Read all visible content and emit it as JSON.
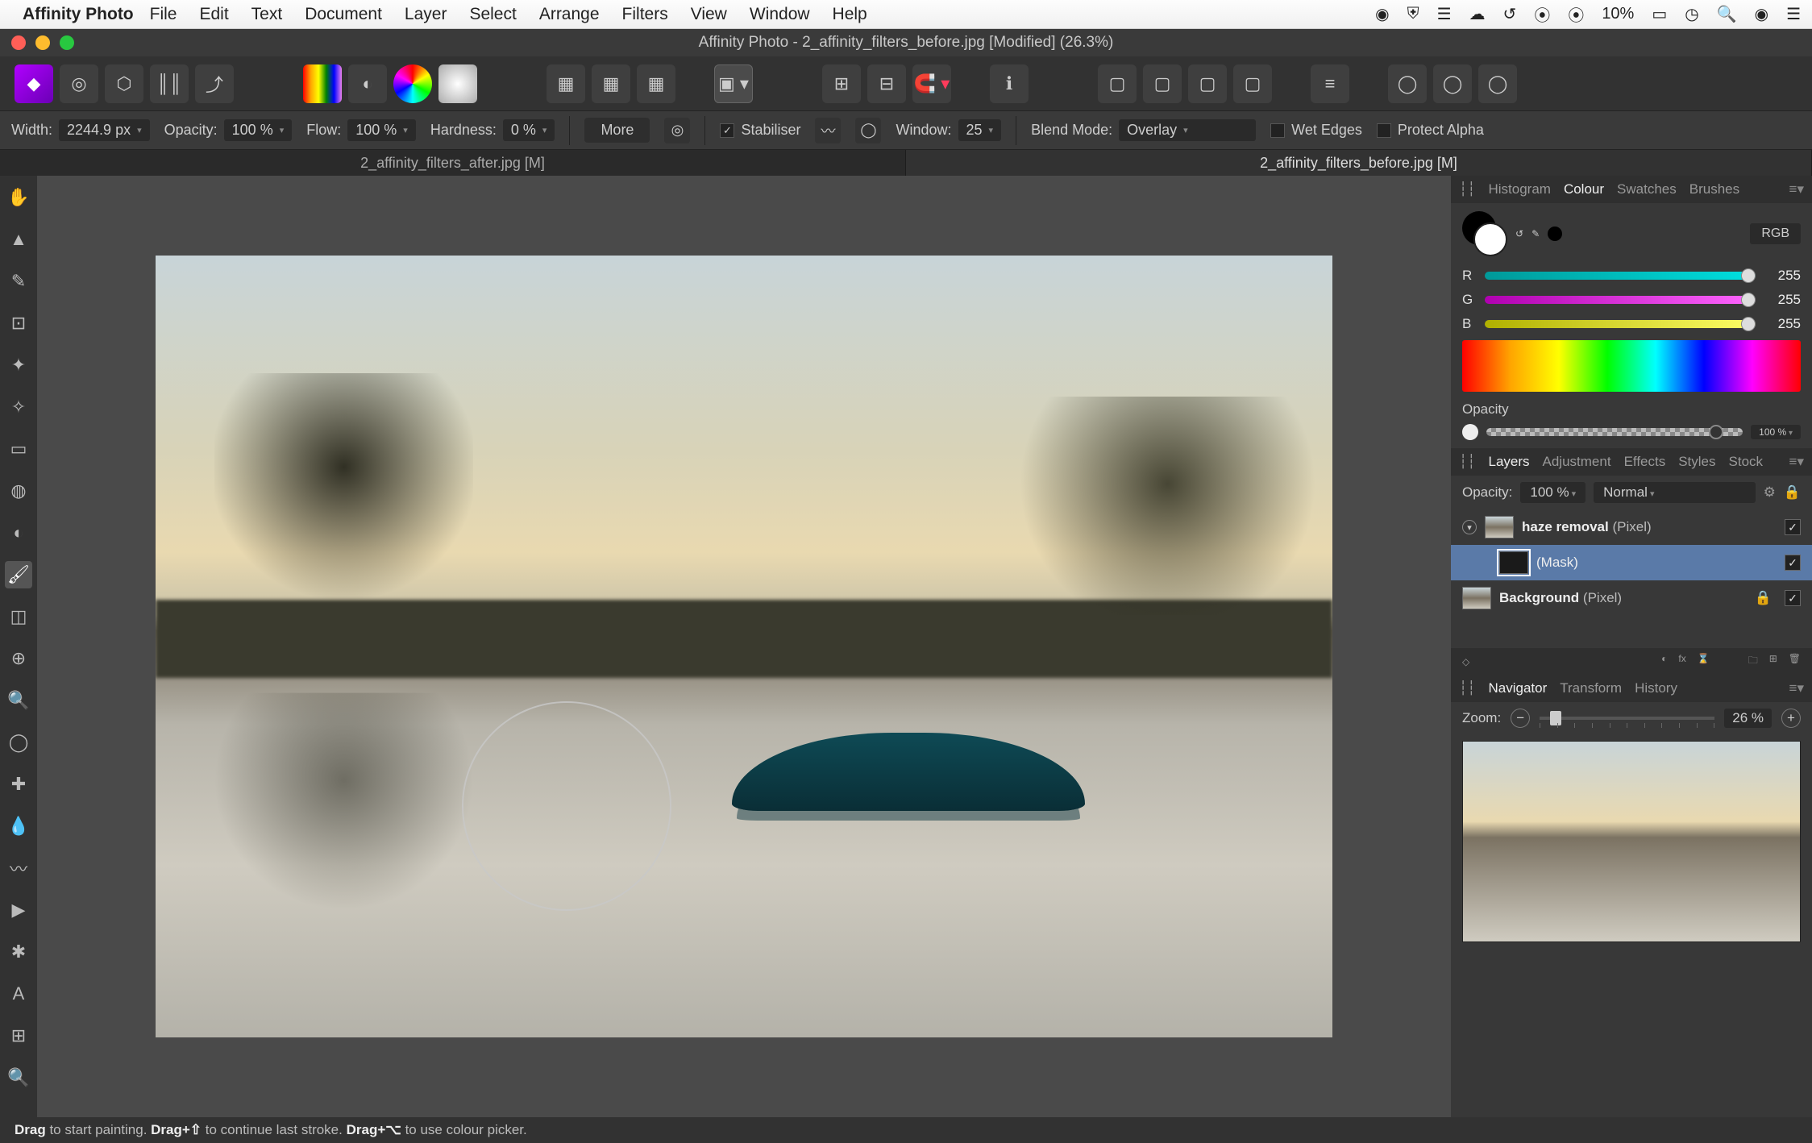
{
  "mac_menu": {
    "app_name": "Affinity Photo",
    "items": [
      "File",
      "Edit",
      "Text",
      "Document",
      "Layer",
      "Select",
      "Arrange",
      "Filters",
      "View",
      "Window",
      "Help"
    ],
    "battery": "10%"
  },
  "window": {
    "title": "Affinity Photo - 2_affinity_filters_before.jpg [Modified] (26.3%)"
  },
  "context": {
    "width_label": "Width:",
    "width_value": "2244.9 px",
    "opacity_label": "Opacity:",
    "opacity_value": "100 %",
    "flow_label": "Flow:",
    "flow_value": "100 %",
    "hardness_label": "Hardness:",
    "hardness_value": "0 %",
    "more": "More",
    "stabiliser": "Stabiliser",
    "window_label": "Window:",
    "window_value": "25",
    "blend_label": "Blend Mode:",
    "blend_value": "Overlay",
    "wet_edges": "Wet Edges",
    "protect_alpha": "Protect Alpha"
  },
  "doc_tabs": [
    {
      "label": "2_affinity_filters_after.jpg [M]",
      "active": false
    },
    {
      "label": "2_affinity_filters_before.jpg [M]",
      "active": true
    }
  ],
  "panels": {
    "top_tabs": [
      "Histogram",
      "Colour",
      "Swatches",
      "Brushes"
    ],
    "top_active": "Colour",
    "colour": {
      "mode": "RGB",
      "r": "255",
      "g": "255",
      "b": "255",
      "opacity_label": "Opacity",
      "opacity_value": "100 %"
    },
    "mid_tabs": [
      "Layers",
      "Adjustment",
      "Effects",
      "Styles",
      "Stock"
    ],
    "mid_active": "Layers",
    "layers_header": {
      "opacity_label": "Opacity:",
      "opacity_value": "100 %",
      "blend": "Normal"
    },
    "layers": [
      {
        "name": "haze removal",
        "type": "(Pixel)",
        "selected": false,
        "visible": true,
        "expandable": true
      },
      {
        "name": "(Mask)",
        "type": "",
        "selected": true,
        "visible": true,
        "child": true
      },
      {
        "name": "Background",
        "type": "(Pixel)",
        "selected": false,
        "visible": true,
        "locked": true
      }
    ],
    "bottom_tabs": [
      "Navigator",
      "Transform",
      "History"
    ],
    "bottom_active": "Navigator",
    "navigator": {
      "zoom_label": "Zoom:",
      "zoom_value": "26 %"
    }
  },
  "statusbar": {
    "drag": "Drag",
    "t1": " to start painting. ",
    "drag_shift": "Drag+⇧",
    "t2": " to continue last stroke. ",
    "drag_opt": "Drag+⌥",
    "t3": " to use colour picker."
  }
}
